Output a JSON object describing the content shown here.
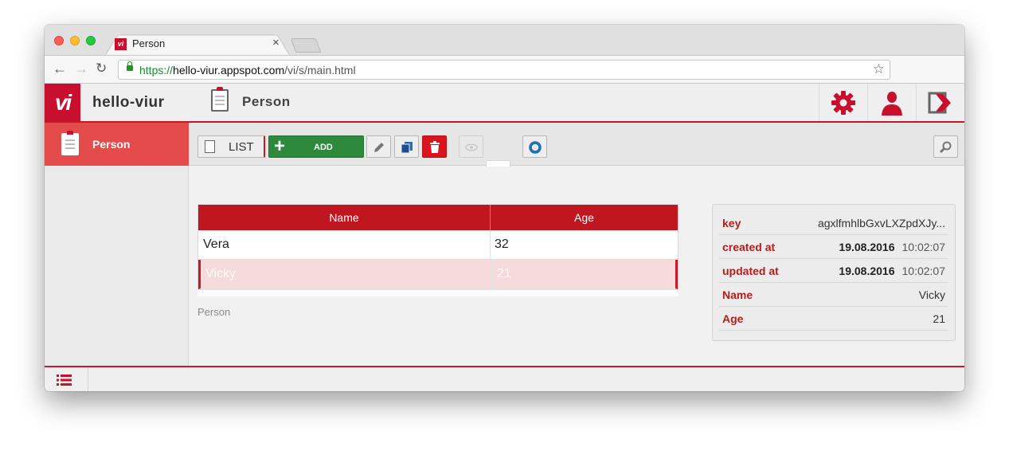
{
  "browser": {
    "tab_title": "Person",
    "tab_close": "×",
    "url_scheme": "https://",
    "url_host": "hello-viur.appspot.com",
    "url_path": "/vi/s/main.html",
    "back": "←",
    "forward": "→",
    "reload": "↻",
    "star": "☆",
    "favicon_text": "vi"
  },
  "app": {
    "logo_text": "vi",
    "name": "hello-viur",
    "module_title": "Person",
    "accent_color": "#c8102e"
  },
  "sidebar": {
    "items": [
      {
        "label": "Person",
        "icon": "clipboard-icon",
        "active": true
      }
    ]
  },
  "actions": {
    "list_label": "LIST",
    "add_label": "ADD",
    "add_symbol": "+"
  },
  "table": {
    "columns": [
      "Name",
      "Age"
    ],
    "rows": [
      {
        "name": "Vera",
        "age": "32"
      },
      {
        "name": "Vicky",
        "age": "21",
        "selected": true
      }
    ],
    "caption": "Person"
  },
  "detail": {
    "key_label": "key",
    "key_value": "agxlfmhlbGxvLXZpdXJy...",
    "created_label": "created at",
    "created_date": "19.08.2016",
    "created_time": "10:02:07",
    "updated_label": "updated at",
    "updated_date": "19.08.2016",
    "updated_time": "10:02:07",
    "name_label": "Name",
    "name_value": "Vicky",
    "age_label": "Age",
    "age_value": "21"
  }
}
